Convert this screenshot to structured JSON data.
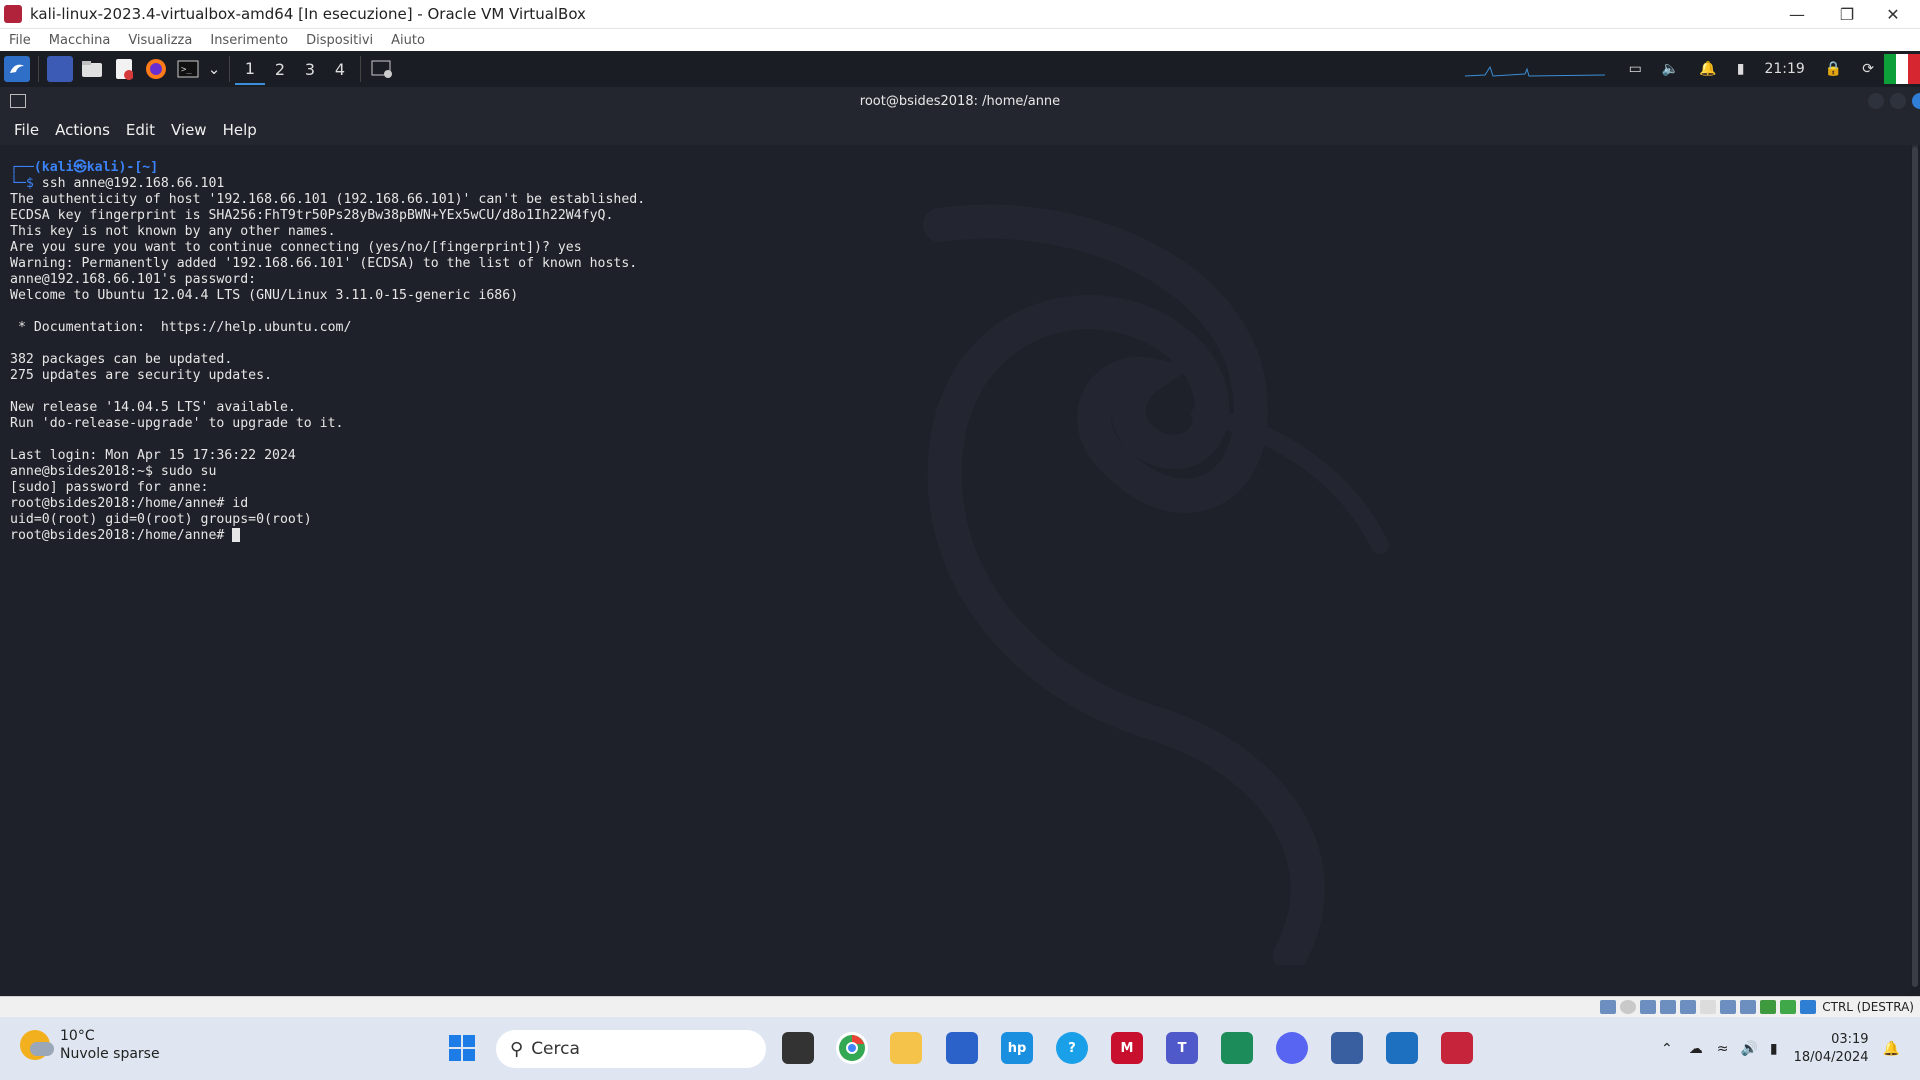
{
  "vbox": {
    "title": "kali-linux-2023.4-virtualbox-amd64 [In esecuzione] - Oracle VM VirtualBox",
    "menu": [
      "File",
      "Macchina",
      "Visualizza",
      "Inserimento",
      "Dispositivi",
      "Aiuto"
    ],
    "status_host_key": "CTRL (DESTRA)"
  },
  "kali_panel": {
    "workspaces": [
      "1",
      "2",
      "3",
      "4"
    ],
    "active_workspace": "1",
    "time": "21:19"
  },
  "terminal": {
    "title": "root@bsides2018: /home/anne",
    "menu": [
      "File",
      "Actions",
      "Edit",
      "View",
      "Help"
    ],
    "prompt_user": "(kali㉿kali)-[~]",
    "prompt_command": "ssh anne@192.168.66.101",
    "output_lines": [
      "The authenticity of host '192.168.66.101 (192.168.66.101)' can't be established.",
      "ECDSA key fingerprint is SHA256:FhT9tr50Ps28yBw38pBWN+YEx5wCU/d8o1Ih22W4fyQ.",
      "This key is not known by any other names.",
      "Are you sure you want to continue connecting (yes/no/[fingerprint])? yes",
      "Warning: Permanently added '192.168.66.101' (ECDSA) to the list of known hosts.",
      "anne@192.168.66.101's password:",
      "Welcome to Ubuntu 12.04.4 LTS (GNU/Linux 3.11.0-15-generic i686)",
      "",
      " * Documentation:  https://help.ubuntu.com/",
      "",
      "382 packages can be updated.",
      "275 updates are security updates.",
      "",
      "New release '14.04.5 LTS' available.",
      "Run 'do-release-upgrade' to upgrade to it.",
      "",
      "Last login: Mon Apr 15 17:36:22 2024",
      "anne@bsides2018:~$ sudo su",
      "[sudo] password for anne:",
      "root@bsides2018:/home/anne# id",
      "uid=0(root) gid=0(root) groups=0(root)"
    ],
    "current_prompt": "root@bsides2018:/home/anne# "
  },
  "windows_taskbar": {
    "weather_temp": "10°C",
    "weather_desc": "Nuvole sparse",
    "search_placeholder": "Cerca",
    "clock_time": "03:19",
    "clock_date": "18/04/2024"
  }
}
